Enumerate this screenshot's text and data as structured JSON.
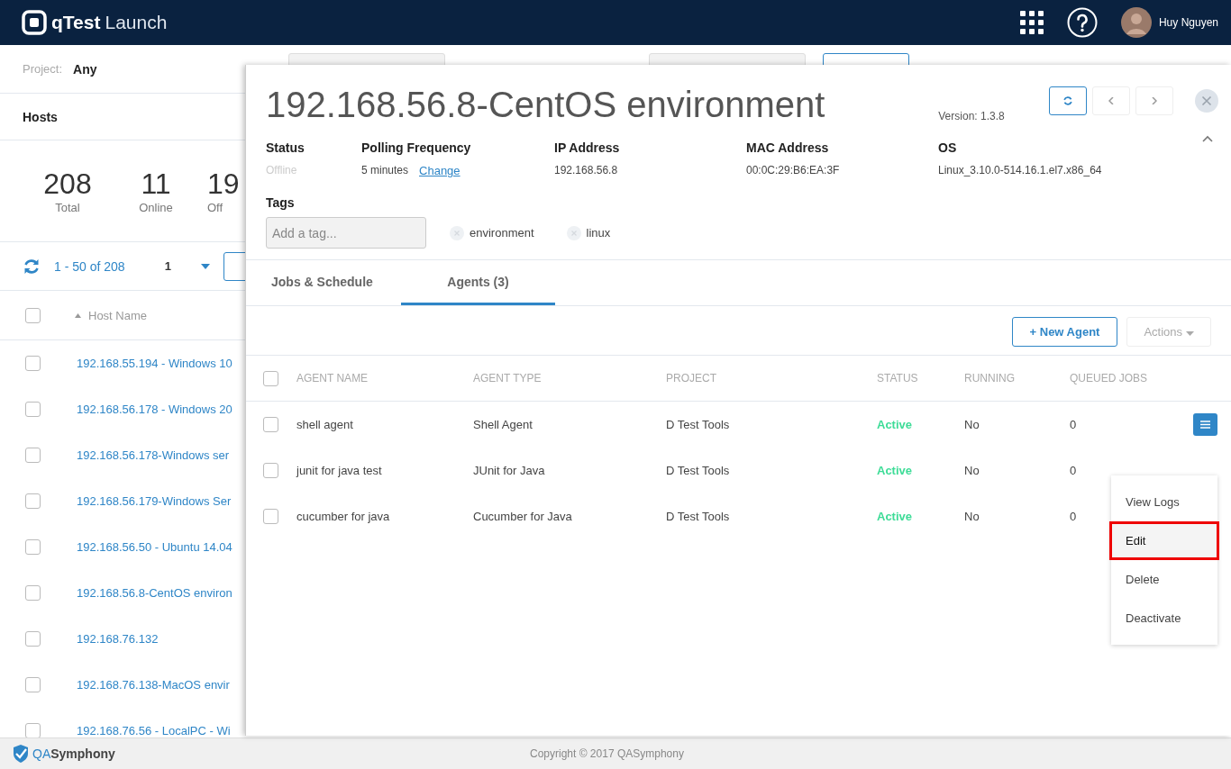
{
  "header": {
    "logo_bold": "qTest",
    "logo_light": "Launch",
    "user_name": "Huy Nguyen"
  },
  "filter_bar": {
    "project_label": "Project:",
    "project_value": "Any"
  },
  "hosts_panel": {
    "title": "Hosts",
    "stats": [
      {
        "value": "208",
        "label": "Total"
      },
      {
        "value": "11",
        "label": "Online"
      },
      {
        "value": "19",
        "label": "Off"
      }
    ],
    "pagination": {
      "range": "1 - 50 of 208",
      "page": "1"
    },
    "table": {
      "column": "Host Name",
      "select_all_checked": false,
      "rows": [
        {
          "name": "192.168.55.194 - Windows 10",
          "checked": false
        },
        {
          "name": "192.168.56.178 - Windows 20",
          "checked": false
        },
        {
          "name": "192.168.56.178-Windows ser",
          "checked": false
        },
        {
          "name": "192.168.56.179-Windows Ser",
          "checked": false
        },
        {
          "name": "192.168.56.50 - Ubuntu 14.04",
          "checked": false
        },
        {
          "name": "192.168.56.8-CentOS environ",
          "checked": false
        },
        {
          "name": "192.168.76.132",
          "checked": false
        },
        {
          "name": "192.168.76.138-MacOS envir",
          "checked": false
        },
        {
          "name": "192.168.76.56 - LocalPC - Wi",
          "checked": false
        }
      ]
    }
  },
  "detail": {
    "title": "192.168.56.8-CentOS environment",
    "version": "Version: 1.3.8",
    "fields": [
      {
        "label": "Status",
        "value": "Offline",
        "kind": "muted"
      },
      {
        "label": "Polling Frequency",
        "value": "5 minutes",
        "kind": "link",
        "link": "Change"
      },
      {
        "label": "IP Address",
        "value": "192.168.56.8",
        "kind": "plain"
      },
      {
        "label": "MAC Address",
        "value": "00:0C:29:B6:EA:3F",
        "kind": "plain"
      },
      {
        "label": "OS",
        "value": "Linux_3.10.0-514.16.1.el7.x86_64",
        "kind": "plain"
      }
    ],
    "tags_label": "Tags",
    "tag_placeholder": "Add a tag...",
    "tags": [
      "environment",
      "linux"
    ],
    "tabs": [
      {
        "label": "Jobs & Schedule",
        "selected": false
      },
      {
        "label": "Agents (3)",
        "selected": true
      }
    ],
    "new_agent": "+ New Agent",
    "actions": "Actions",
    "agents_table": {
      "select_all_checked": false,
      "columns": [
        "AGENT NAME",
        "AGENT TYPE",
        "PROJECT",
        "STATUS",
        "RUNNING",
        "QUEUED JOBS"
      ],
      "rows": [
        {
          "name": "shell agent",
          "type": "Shell Agent",
          "project": "D Test Tools",
          "status": "Active",
          "active": true,
          "running": "No",
          "queued": "0",
          "checked": false,
          "menu_open": true
        },
        {
          "name": "junit for java test",
          "type": "JUnit for Java",
          "project": "D Test Tools",
          "status": "Active",
          "active": true,
          "running": "No",
          "queued": "0",
          "checked": false,
          "menu_open": false
        },
        {
          "name": "cucumber for java",
          "type": "Cucumber for Java",
          "project": "D Test Tools",
          "status": "Active",
          "active": true,
          "running": "No",
          "queued": "0",
          "checked": false,
          "menu_open": false
        }
      ]
    },
    "row_menu": [
      {
        "label": "View Logs",
        "highlighted": false
      },
      {
        "label": "Edit",
        "highlighted": true
      },
      {
        "label": "Delete",
        "highlighted": false
      },
      {
        "label": "Deactivate",
        "highlighted": false
      }
    ]
  },
  "footer": {
    "brand_accent": "QA",
    "brand": "Symphony",
    "copyright": "Copyright © 2017 QASymphony"
  }
}
